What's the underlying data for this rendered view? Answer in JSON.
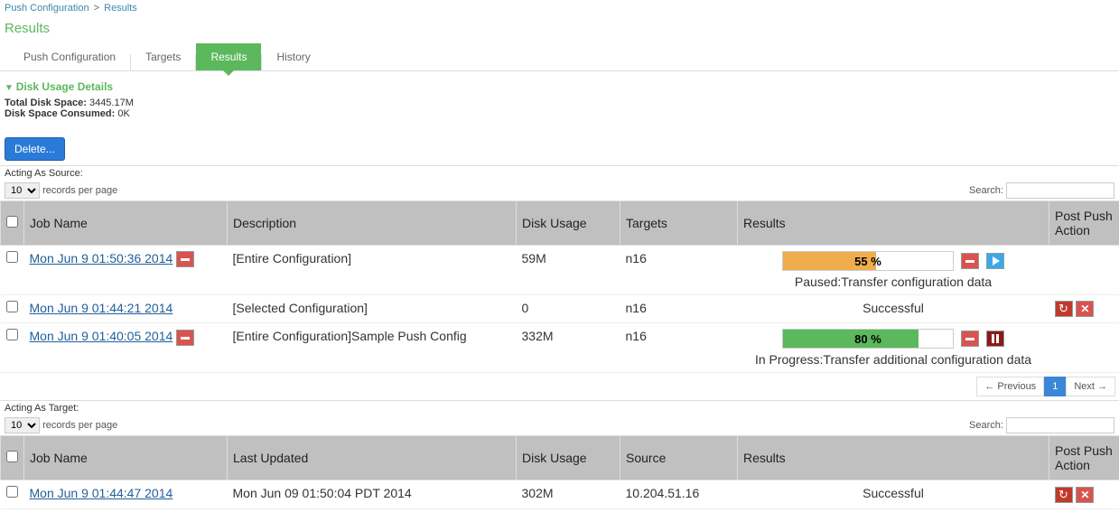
{
  "breadcrumb": {
    "link": "Push Configuration",
    "current": "Results"
  },
  "page_title": "Results",
  "tabs": [
    {
      "label": "Push Configuration",
      "active": false
    },
    {
      "label": "Targets",
      "active": false
    },
    {
      "label": "Results",
      "active": true
    },
    {
      "label": "History",
      "active": false
    }
  ],
  "disk_details": {
    "header": "Disk Usage Details",
    "total_label": "Total Disk Space:",
    "total_value": "3445.17M",
    "consumed_label": "Disk Space Consumed:",
    "consumed_value": "0K"
  },
  "delete_button": "Delete...",
  "source": {
    "title": "Acting As Source:",
    "records_value": "10",
    "records_label": "records per page",
    "search_label": "Search:",
    "columns": {
      "job": "Job Name",
      "desc": "Description",
      "disk": "Disk Usage",
      "targets": "Targets",
      "results": "Results",
      "action": "Post Push Action"
    },
    "rows": [
      {
        "job": "Mon Jun 9 01:50:36 2014",
        "has_stop_inline": true,
        "desc": "[Entire Configuration]",
        "disk": "59M",
        "targets": "n16",
        "progress": {
          "percent": 55,
          "color": "orange",
          "status": "Paused:Transfer configuration data",
          "buttons": [
            "stop",
            "play"
          ]
        }
      },
      {
        "job": "Mon Jun 9 01:44:21 2014",
        "has_stop_inline": false,
        "desc": "[Selected Configuration]",
        "disk": "0",
        "targets": "n16",
        "result_text": "Successful",
        "post_buttons": [
          "refresh",
          "close"
        ]
      },
      {
        "job": "Mon Jun 9 01:40:05 2014",
        "has_stop_inline": true,
        "desc": "[Entire Configuration]Sample Push Config",
        "disk": "332M",
        "targets": "n16",
        "progress": {
          "percent": 80,
          "color": "green",
          "status": "In Progress:Transfer additional configuration data",
          "buttons": [
            "stop",
            "pause"
          ]
        }
      }
    ],
    "pagination": {
      "prev": "← Previous",
      "page": "1",
      "next": "Next →"
    }
  },
  "target": {
    "title": "Acting As Target:",
    "records_value": "10",
    "records_label": "records per page",
    "search_label": "Search:",
    "columns": {
      "job": "Job Name",
      "updated": "Last Updated",
      "disk": "Disk Usage",
      "source": "Source",
      "results": "Results",
      "action": "Post Push Action"
    },
    "rows": [
      {
        "job": "Mon Jun 9 01:44:47 2014",
        "updated": "Mon Jun 09 01:50:04 PDT 2014",
        "disk": "302M",
        "source": "10.204.51.16",
        "result_text": "Successful",
        "post_buttons": [
          "refresh",
          "close"
        ]
      }
    ]
  }
}
